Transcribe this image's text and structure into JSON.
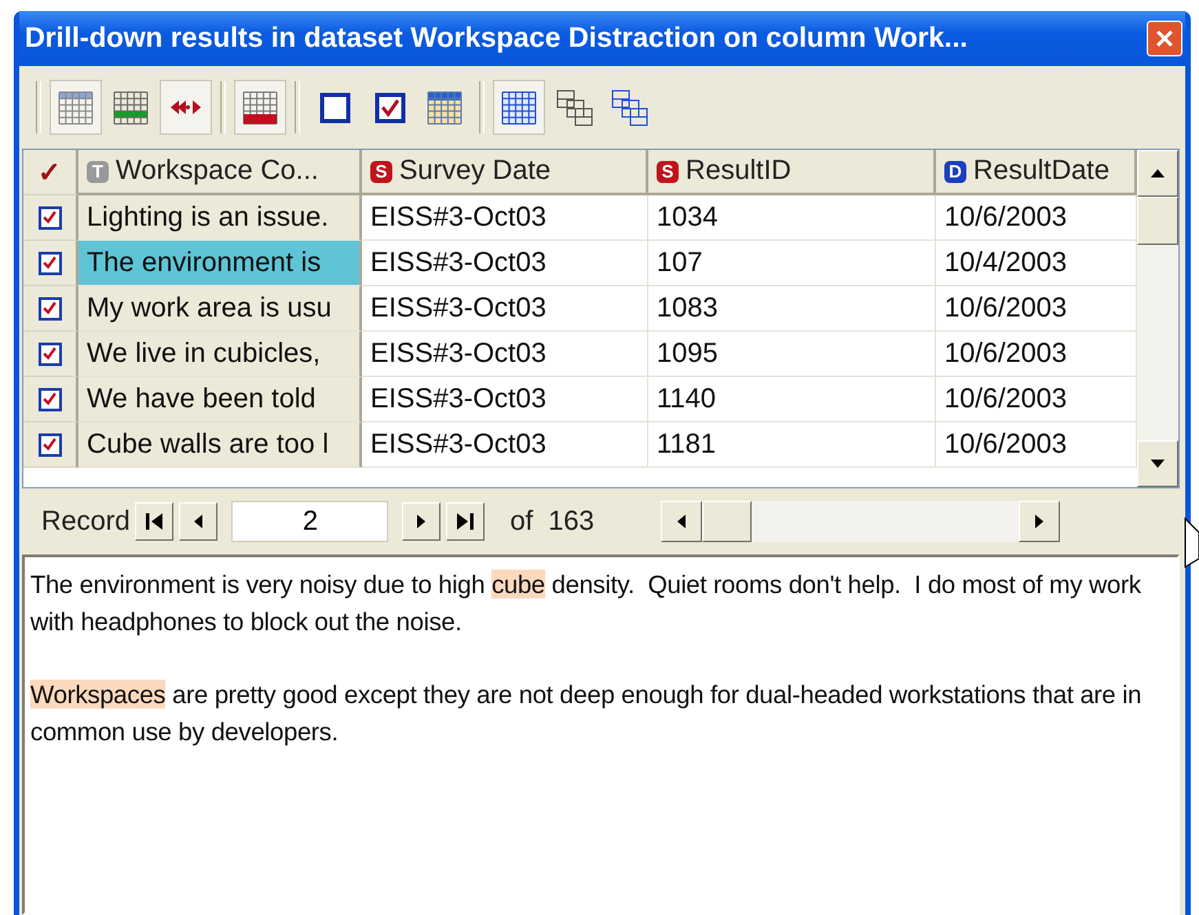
{
  "window": {
    "title": "Drill-down results in dataset Workspace Distraction on column Work..."
  },
  "toolbar": [
    {
      "buttons": [
        {
          "kind": "grid",
          "pressed": true
        },
        {
          "kind": "lines",
          "pressed": false
        },
        {
          "kind": "arrows",
          "pressed": true
        }
      ]
    },
    {
      "buttons": [
        {
          "kind": "gridkey",
          "pressed": true
        }
      ]
    },
    {
      "buttons": [
        {
          "kind": "boxempty",
          "pressed": false
        },
        {
          "kind": "boxchecked",
          "pressed": false
        },
        {
          "kind": "calendar",
          "pressed": false
        }
      ]
    },
    {
      "buttons": [
        {
          "kind": "gridblue",
          "pressed": true
        },
        {
          "kind": "cascadegray",
          "pressed": false
        },
        {
          "kind": "cascadeblue",
          "pressed": false
        }
      ]
    }
  ],
  "table": {
    "check_header": "✓",
    "columns": [
      {
        "label": "Workspace Co...",
        "badge": "T",
        "color": "#9a9a9a"
      },
      {
        "label": "Survey Date",
        "badge": "S",
        "color": "#c0141c"
      },
      {
        "label": "ResultID",
        "badge": "S",
        "color": "#c0141c"
      },
      {
        "label": "ResultDate",
        "badge": "D",
        "color": "#1a3fc0"
      }
    ],
    "rows": [
      {
        "checked": true,
        "selected": false,
        "cells": [
          "Lighting is an issue.",
          "EISS#3-Oct03",
          "1034",
          "10/6/2003"
        ]
      },
      {
        "checked": true,
        "selected": true,
        "cells": [
          "The environment is",
          "EISS#3-Oct03",
          "107",
          "10/4/2003"
        ]
      },
      {
        "checked": true,
        "selected": false,
        "cells": [
          "My work area is usu",
          "EISS#3-Oct03",
          "1083",
          "10/6/2003"
        ]
      },
      {
        "checked": true,
        "selected": false,
        "cells": [
          "We live in cubicles,",
          "EISS#3-Oct03",
          "1095",
          "10/6/2003"
        ]
      },
      {
        "checked": true,
        "selected": false,
        "cells": [
          "We have been told",
          "EISS#3-Oct03",
          "1140",
          "10/6/2003"
        ]
      },
      {
        "checked": true,
        "selected": false,
        "cells": [
          "Cube walls are too l",
          "EISS#3-Oct03",
          "1181",
          "10/6/2003"
        ]
      }
    ]
  },
  "navigator": {
    "label": "Record",
    "value": "2",
    "total": "of  163"
  },
  "detail": [
    [
      {
        "text": "The environment is very noisy due to high ",
        "highlight": false
      },
      {
        "text": "cube",
        "highlight": true
      },
      {
        "text": " density.  Quiet rooms don't help.  I do most of my work with headphones to block out the noise.",
        "highlight": false
      }
    ],
    [
      {
        "text": "Workspaces",
        "highlight": true
      },
      {
        "text": " are pretty good except they are not deep enough for dual-headed workstations that are in common use by developers.",
        "highlight": false
      }
    ]
  ]
}
